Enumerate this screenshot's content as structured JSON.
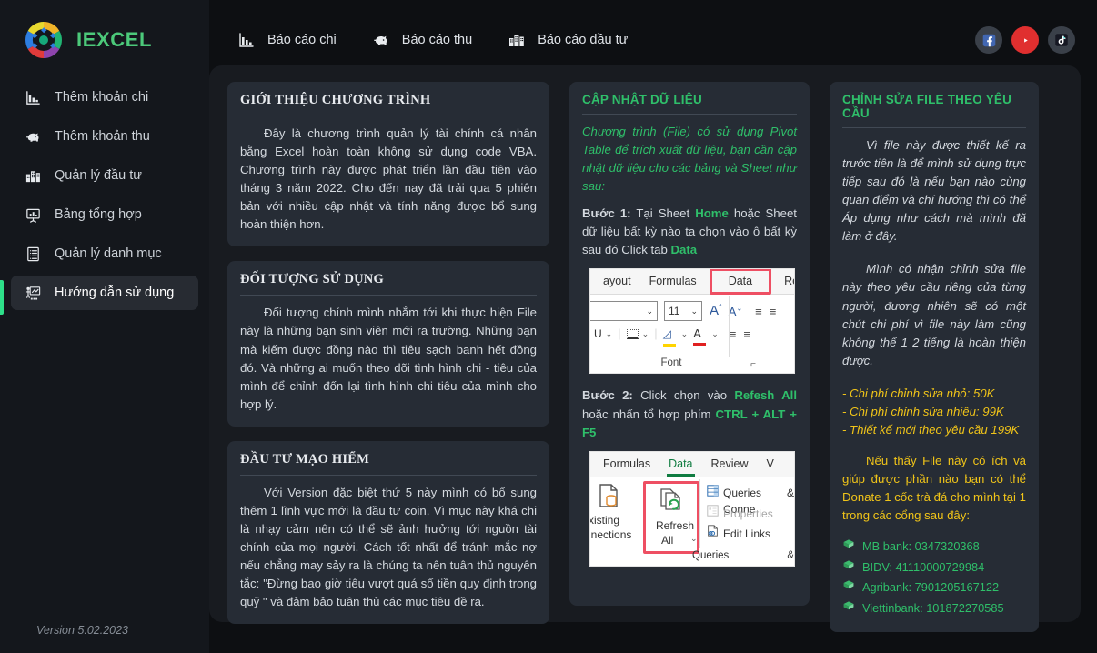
{
  "brand": {
    "name": "IEXCEL",
    "logo_icon": "iexcel-logo-icon"
  },
  "sidebar": {
    "items": [
      {
        "label": "Thêm khoản chi",
        "icon": "bar-chart-down-icon",
        "active": false
      },
      {
        "label": "Thêm khoản thu",
        "icon": "piggy-bank-icon",
        "active": false
      },
      {
        "label": "Quản lý đầu tư",
        "icon": "buildings-icon",
        "active": false
      },
      {
        "label": "Bảng tổng hợp",
        "icon": "presentation-chart-icon",
        "active": false
      },
      {
        "label": "Quản lý danh mục",
        "icon": "list-document-icon",
        "active": false
      },
      {
        "label": "Hướng dẫn sử dụng",
        "icon": "presenter-board-icon",
        "active": true
      }
    ],
    "version": "Version 5.02.2023"
  },
  "topnav": {
    "items": [
      {
        "label": "Báo cáo chi",
        "icon": "bar-chart-down-icon"
      },
      {
        "label": "Báo cáo thu",
        "icon": "piggy-bank-icon"
      },
      {
        "label": "Báo cáo đầu tư",
        "icon": "buildings-icon"
      }
    ],
    "socials": [
      {
        "name": "facebook-icon",
        "color": "#3b5998"
      },
      {
        "name": "youtube-icon",
        "color": "#e02f2f"
      },
      {
        "name": "tiktok-icon",
        "color": "#161823"
      }
    ]
  },
  "colors": {
    "accent_green": "#2fbf6a",
    "brand_green": "#4cc97a",
    "yellow": "#f0c419",
    "ribbon_highlight_red": "#ee4f63",
    "panel_bg": "#181b20",
    "card_bg": "#262c35",
    "sidebar_bg": "#14171c"
  },
  "cards": {
    "intro": {
      "title": "GIỚI THIỆU CHƯƠNG TRÌNH",
      "body": "Đây là chương trình quản lý tài chính cá nhân bằng Excel hoàn toàn không sử dụng code VBA. Chương trình này được phát triển lần đầu tiên vào tháng 3 năm 2022. Cho đến nay đã trải qua 5 phiên bản với nhiều cập nhật và tính năng được bổ sung hoàn thiện hơn."
    },
    "audience": {
      "title": "ĐỐI TƯỢNG SỬ DỤNG",
      "body": "Đối tượng chính mình nhắm tới khi thực hiện File này là những bạn sinh viên mới ra trường. Những bạn mà kiếm được đồng nào thì tiêu sạch banh hết đồng đó. Và những ai muốn theo dõi tình hình chi - tiêu của mình để chỉnh đốn lại tình hình chi tiêu của mình cho hợp lý."
    },
    "risk": {
      "title": "ĐẦU TƯ MẠO HIỂM",
      "body": "Với Version đặc biệt thứ 5 này mình có bổ sung thêm 1 lĩnh vực mới là đầu tư coin. Vì mục này khá chi là nhạy cảm nên có thể sẽ ảnh hưởng tới nguồn tài chính của mọi người. Cách tốt nhất để tránh mắc nợ nếu chẳng may sảy ra là chúng ta nên tuân thủ nguyên tắc: \"Đừng bao giờ tiêu vượt quá số tiền quy định trong quỹ \" và đảm bảo tuân thủ các mục tiêu  đề ra."
    },
    "update": {
      "title": "CẬP NHẬT DỮ LIỆU",
      "intro": "Chương trình (File) có sử dụng Pivot Table để trích xuất dữ liệu, bạn cần cập nhật dữ liệu cho các bảng và Sheet như sau:",
      "step1_label": "Bước 1:",
      "step1_a": " Tại Sheet ",
      "step1_kw1": "Home",
      "step1_b": " hoặc Sheet dữ liệu bất kỳ nào ta chọn vào ô bất kỳ sau đó Click tab ",
      "step1_kw2": "Data",
      "step2_label": "Bước 2:",
      "step2_a": " Click chọn vào ",
      "step2_kw1": "Refesh All",
      "step2_b": " hoặc nhấn tổ hợp phím ",
      "step2_kw2": "CTRL + ALT + F5"
    },
    "edit": {
      "title": "CHỈNH SỬA FILE THEO YÊU CẦU",
      "p1": "Vì file này được thiết kế ra trước tiên là để mình sử dụng trực tiếp sau đó là nếu bạn nào cùng quan điểm và chí hướng thì có thể Áp dụng như cách mà mình đã làm ở đây.",
      "p2": "Mình có nhận chỉnh sửa file này theo yêu cầu riêng của từng người, đương nhiên sẽ có một chút chi phí vì file này làm cũng không thể 1 2 tiếng là hoàn thiện được.",
      "prices": [
        "- Chi phí chỉnh sửa nhỏ: 50K",
        "- Chi phí chỉnh sửa nhiều: 99K",
        "- Thiết kế mới theo yêu cầu 199K"
      ],
      "donate": "Nếu thấy File này có ích và giúp được phần nào  bạn có thể Donate 1 cốc trà đá cho mình tại 1 trong các cổng sau đây:",
      "banks": [
        {
          "icon": "money-icon",
          "label": "MB bank: 0347320368"
        },
        {
          "icon": "money-icon",
          "label": "BIDV: 41110000729984"
        },
        {
          "icon": "money-icon",
          "label": "Agribank: 7901205167122"
        },
        {
          "icon": "money-icon",
          "label": "Viettinbank: 101872270585"
        }
      ]
    }
  },
  "ribbon1": {
    "tabs": [
      "ayout",
      "Formulas",
      "Data",
      "Rev"
    ],
    "highlighted_tab": "Data",
    "font_size_value": "11",
    "group_label": "Font"
  },
  "ribbon2": {
    "tabs": [
      "Formulas",
      "Data",
      "Review",
      "V"
    ],
    "active_tab": "Data",
    "existing_label_1": "xisting",
    "existing_label_2": "nnections",
    "refresh_label_1": "Refresh",
    "refresh_label_2": "All",
    "queries_label": "Queries & Conne",
    "properties_label": "Properties",
    "edit_links_label": "Edit Links",
    "group_label": "Queries & Connections"
  }
}
